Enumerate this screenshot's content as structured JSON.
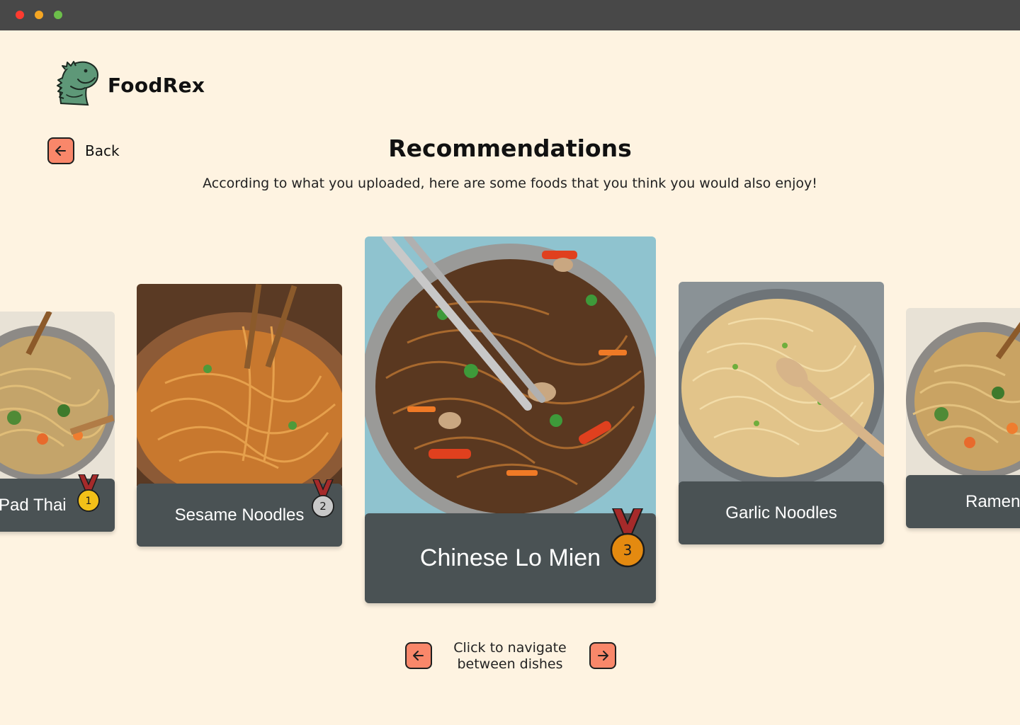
{
  "app": {
    "name": "FoodRex",
    "logo_icon": "dinosaur-logo-icon"
  },
  "window": {
    "controls": [
      "close",
      "minimize",
      "maximize"
    ],
    "colors": [
      "#ff5f57",
      "#febc2e",
      "#28c840"
    ]
  },
  "header": {
    "back_label": "Back",
    "title": "Recommendations",
    "subtitle": "According to what you uploaded, here are some foods that you think you would also enjoy!"
  },
  "dishes": [
    {
      "name": "Pad Thai",
      "rank": "1",
      "medal": "gold"
    },
    {
      "name": "Sesame Noodles",
      "rank": "2",
      "medal": "silver"
    },
    {
      "name": "Chinese Lo Mien",
      "rank": "3",
      "medal": "bronze"
    },
    {
      "name": "Garlic Noodles"
    },
    {
      "name": "Ramen"
    }
  ],
  "navigation": {
    "hint_line1": "Click to navigate",
    "hint_line2": "between dishes"
  },
  "colors": {
    "background": "#fef3e1",
    "accent": "#f9876a",
    "card_label": "#4a5254",
    "gold": "#f3c018",
    "silver": "#c8c8c8",
    "bronze": "#e48a10"
  }
}
